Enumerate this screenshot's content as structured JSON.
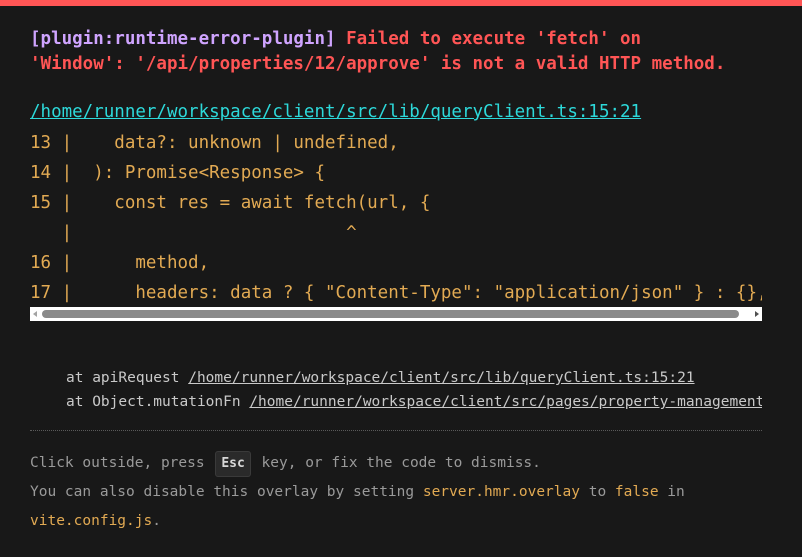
{
  "error": {
    "plugin": "[plugin:runtime-error-plugin]",
    "message_line1": " Failed to execute 'fetch' on",
    "message_line2": "'Window': '/api/properties/12/approve' is not a valid HTTP method."
  },
  "file_link": "/home/runner/workspace/client/src/lib/queryClient.ts:15:21",
  "code_frame": [
    "13 |    data?: unknown | undefined,",
    "14 |  ): Promise<Response> {",
    "15 |    const res = await fetch(url, {",
    "   |                          ^",
    "16 |      method,",
    "17 |      headers: data ? { \"Content-Type\": \"application/json\" } : {},"
  ],
  "stack": [
    {
      "prefix": "at apiRequest ",
      "path": "/home/runner/workspace/client/src/lib/queryClient.ts:15:21"
    },
    {
      "prefix": "at Object.mutationFn ",
      "path": "/home/runner/workspace/client/src/pages/property-management.tsx"
    }
  ],
  "tips": {
    "line1_before": "Click outside, press ",
    "esc_key": "Esc",
    "line1_after": " key, or fix the code to dismiss.",
    "line2_before": "You can also disable this overlay by setting ",
    "setting": "server.hmr.overlay",
    "line2_mid": " to ",
    "value": "false",
    "line2_after": " in",
    "config_file": "vite.config.js",
    "line3_after": "."
  },
  "colors": {
    "accent_red": "#ff5555",
    "plugin_purple": "#cfa4ff",
    "link_cyan": "#2dd9da",
    "code_yellow": "#e2aa53",
    "background": "#181818"
  }
}
